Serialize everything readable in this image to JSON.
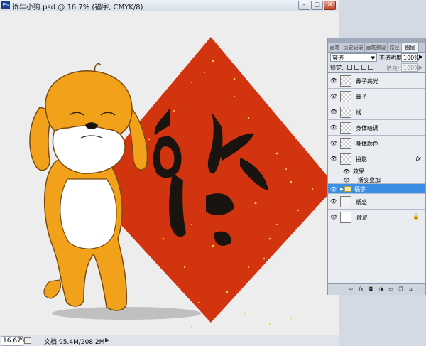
{
  "window": {
    "title": "贺年小狗.psd @ 16.7% (福字, CMYK/8)",
    "app_icon": "Ps",
    "buttons": {
      "minimize": "–",
      "maximize": "□",
      "close": "✕"
    }
  },
  "status": {
    "zoom": "16.67%",
    "doc_info": "文档:95.4M/208.2M",
    "arrow": "▶"
  },
  "canvas": {
    "fu_char": "福",
    "colors": {
      "red": "#d1340e",
      "dog_orange": "#f2a11a",
      "ink": "#1a1410",
      "gold": "#f5d14a"
    }
  },
  "panel": {
    "tabs": [
      "画笔",
      "历史记录",
      "画笔预设",
      "路径",
      "图层"
    ],
    "active_tab": 4,
    "blend_mode": "穿透",
    "opacity_label": "不透明度:",
    "opacity_value": "100%",
    "lock_label": "锁定:",
    "fill_label": "填充:",
    "fill_value": "100%",
    "layers": [
      {
        "name": "鼻子高光",
        "thumb": "transparent"
      },
      {
        "name": "鼻子",
        "thumb": "transparent"
      },
      {
        "name": "线",
        "thumb": "transparent"
      },
      {
        "name": "身体暗调",
        "thumb": "transparent"
      },
      {
        "name": "身体颜色",
        "thumb": "transparent"
      },
      {
        "name": "投影",
        "thumb": "transparent",
        "fx": "fx"
      }
    ],
    "effects_label": "效果",
    "effect_item": "渐变叠加",
    "group_layer": "福字",
    "paper_layer": "纸感",
    "background_layer": "背景",
    "eye_icon": "eye-icon"
  }
}
